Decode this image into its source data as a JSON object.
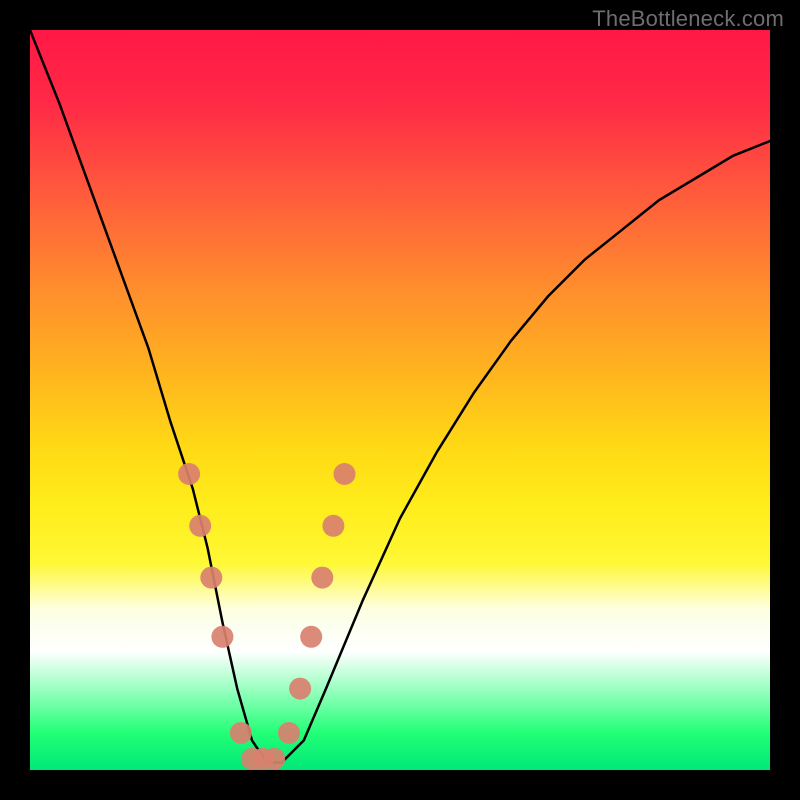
{
  "watermark": "TheBottleneck.com",
  "chart_data": {
    "type": "line",
    "title": "",
    "xlabel": "",
    "ylabel": "",
    "xlim": [
      0,
      100
    ],
    "ylim": [
      0,
      100
    ],
    "series": [
      {
        "name": "bottleneck-curve",
        "x": [
          0,
          4,
          8,
          12,
          16,
          19,
          22,
          24,
          26,
          28,
          30,
          32,
          34,
          37,
          40,
          45,
          50,
          55,
          60,
          65,
          70,
          75,
          80,
          85,
          90,
          95,
          100
        ],
        "values": [
          100,
          90,
          79,
          68,
          57,
          47,
          38,
          30,
          20,
          11,
          4,
          1,
          1,
          4,
          11,
          23,
          34,
          43,
          51,
          58,
          64,
          69,
          73,
          77,
          80,
          83,
          85
        ]
      }
    ],
    "markers": {
      "name": "highlighted-points",
      "color": "#d9806f",
      "x": [
        21.5,
        23.0,
        24.5,
        26.0,
        28.5,
        30.0,
        31.5,
        33.0,
        35.0,
        36.5,
        38.0,
        39.5,
        41.0,
        42.5
      ],
      "values": [
        40.0,
        33.0,
        26.0,
        18.0,
        5.0,
        1.5,
        1.5,
        1.5,
        5.0,
        11.0,
        18.0,
        26.0,
        33.0,
        40.0
      ]
    },
    "gradient_note": "Background encodes bottleneck severity: red=high, yellow=medium, green=low"
  }
}
